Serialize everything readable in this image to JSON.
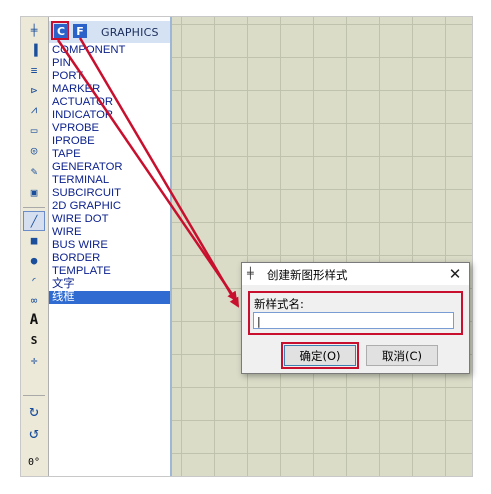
{
  "toolbar": {
    "tools": [
      {
        "icon": "junction-icon",
        "glyph": "╪"
      },
      {
        "icon": "component-icon",
        "glyph": "▐"
      },
      {
        "icon": "label-icon",
        "glyph": "≡"
      },
      {
        "icon": "probe-icon",
        "glyph": "⊳"
      },
      {
        "icon": "graph-icon",
        "glyph": "⩘"
      },
      {
        "icon": "tape-icon",
        "glyph": "▭"
      },
      {
        "icon": "generator-icon",
        "glyph": "◎"
      },
      {
        "icon": "pen-icon",
        "glyph": "✎"
      },
      {
        "icon": "virtual-instrument-icon",
        "glyph": "▣"
      },
      {
        "icon": "line-icon",
        "glyph": "╱"
      },
      {
        "icon": "box-icon",
        "glyph": "■"
      },
      {
        "icon": "circle-icon",
        "glyph": "●"
      },
      {
        "icon": "arc-icon",
        "glyph": "◜"
      },
      {
        "icon": "path-icon",
        "glyph": "∞"
      },
      {
        "icon": "text-icon",
        "glyph": "A"
      },
      {
        "icon": "symbol-icon",
        "glyph": "S"
      },
      {
        "icon": "marker-icon",
        "glyph": "✛"
      },
      {
        "icon": "rotate-cw-icon",
        "glyph": "↻"
      },
      {
        "icon": "rotate-ccw-icon",
        "glyph": "↺"
      }
    ],
    "rotation": "0°"
  },
  "panel": {
    "btn_c": "C",
    "btn_f": "F",
    "title": "GRAPHICS",
    "items": [
      "COMPONENT",
      "PIN",
      "PORT",
      "MARKER",
      "ACTUATOR",
      "INDICATOR",
      "VPROBE",
      "IPROBE",
      "TAPE",
      "GENERATOR",
      "TERMINAL",
      "SUBCIRCUIT",
      "2D GRAPHIC",
      "WIRE DOT",
      "WIRE",
      "BUS WIRE",
      "BORDER",
      "TEMPLATE",
      "文字",
      "线框"
    ],
    "selected_index": 19
  },
  "dialog": {
    "title": "创建新图形样式",
    "close": "✕",
    "field_label": "新样式名:",
    "field_value": "|",
    "ok_label": "确定(O)",
    "cancel_label": "取消(C)"
  },
  "colors": {
    "highlight": "#c8102e",
    "list_text": "#0a1f8c",
    "selection": "#2f6bd0"
  }
}
